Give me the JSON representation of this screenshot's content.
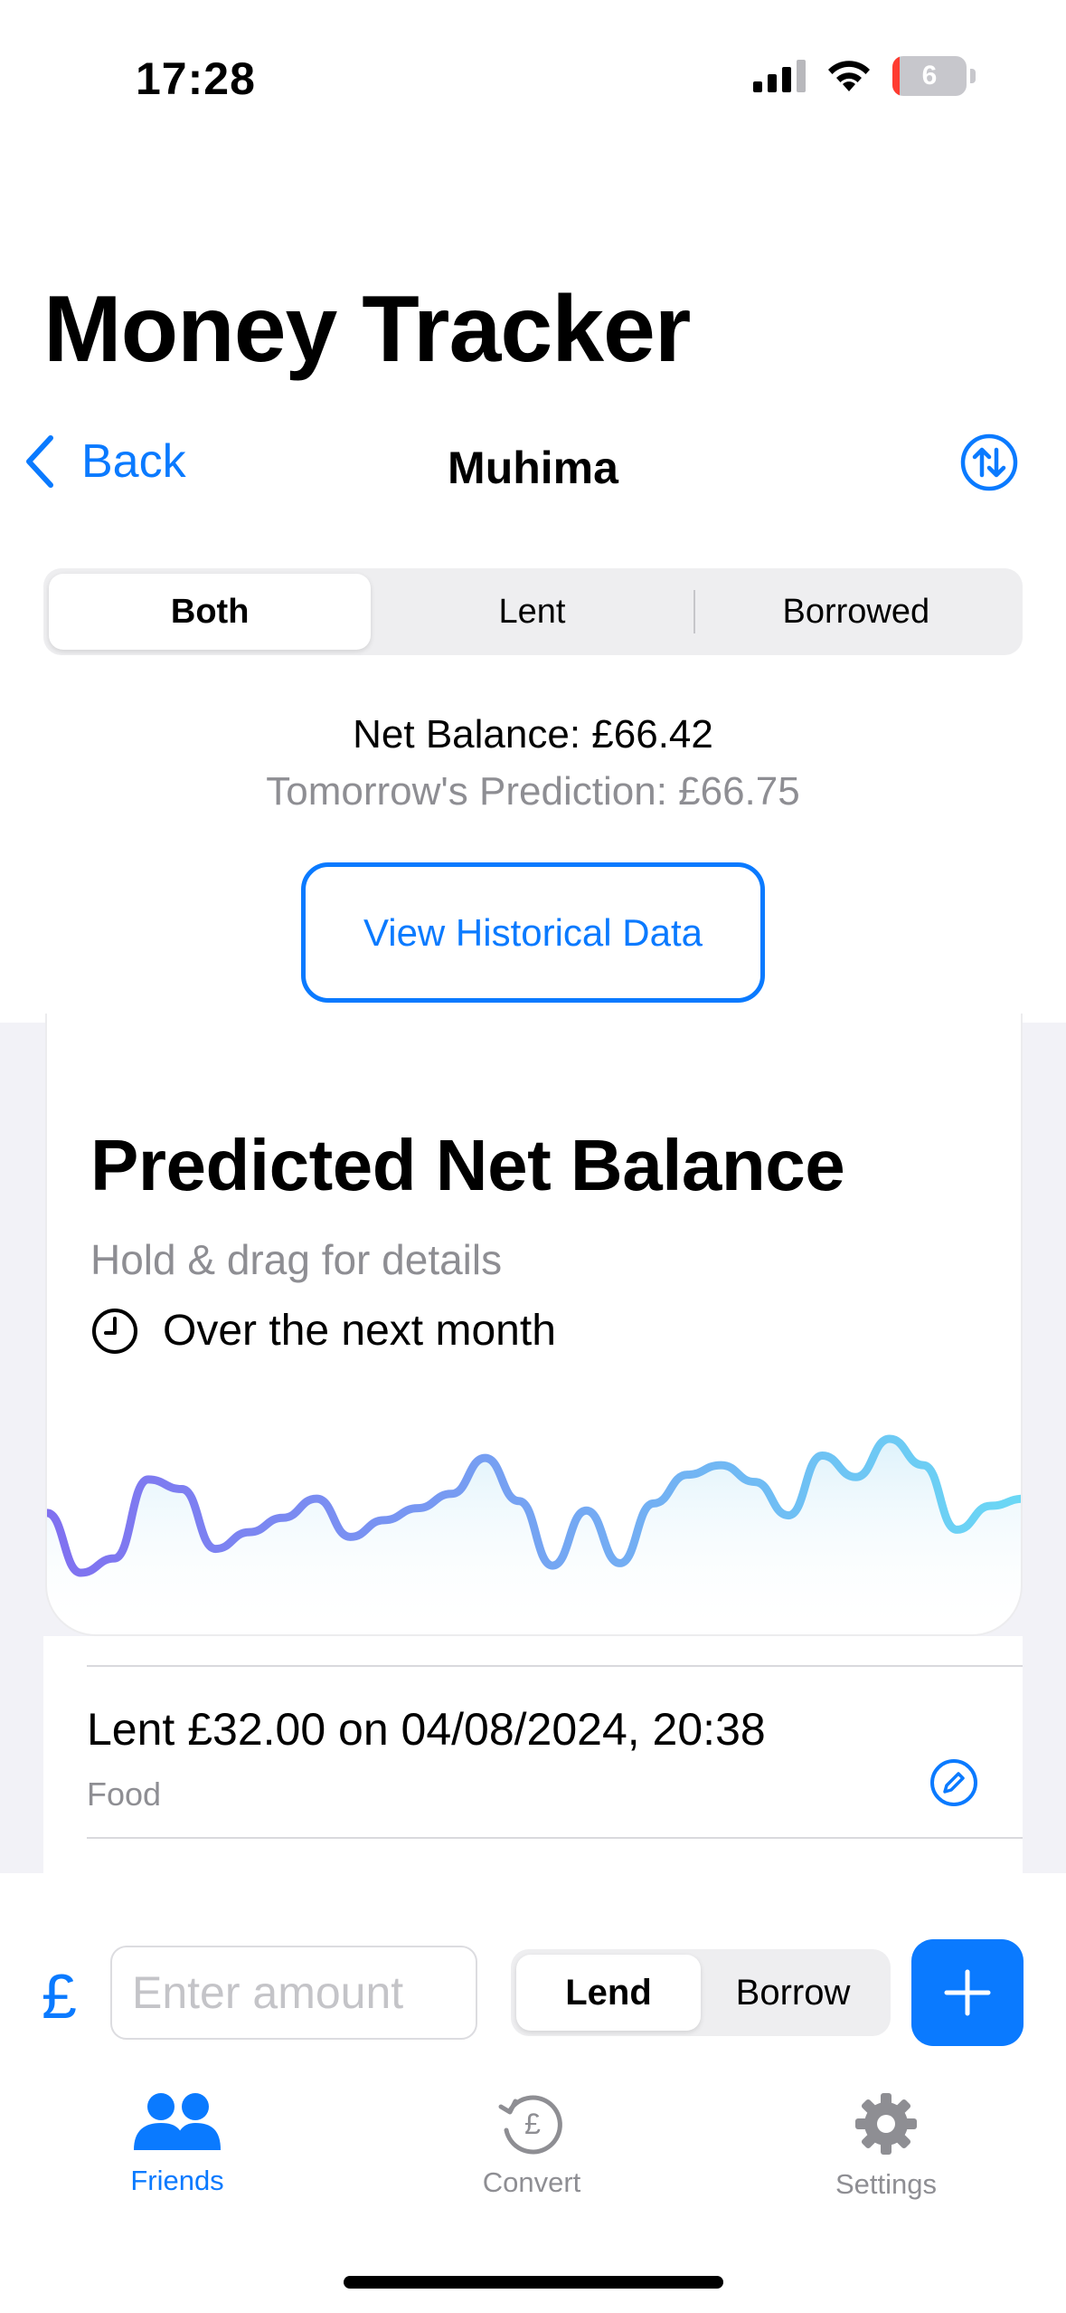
{
  "status_bar": {
    "time": "17:28",
    "battery_level": "6"
  },
  "app": {
    "title": "Money Tracker"
  },
  "nav": {
    "back_label": "Back",
    "title": "Muhima"
  },
  "filter": {
    "options": [
      "Both",
      "Lent",
      "Borrowed"
    ],
    "selected": "Both"
  },
  "summary": {
    "net_balance": "Net Balance: £66.42",
    "prediction": "Tomorrow's Prediction: £66.75"
  },
  "history_button": {
    "label": "View Historical Data"
  },
  "chart": {
    "title": "Predicted Net Balance",
    "hint": "Hold & drag for details",
    "period": "Over the next month",
    "gradient_start": "#8070f0",
    "gradient_end": "#6ad8f5",
    "chart_data": {
      "type": "line",
      "values": [
        62.0,
        59.5,
        60.1,
        63.4,
        63.0,
        60.5,
        61.2,
        61.8,
        62.6,
        61.0,
        61.7,
        62.2,
        62.8,
        64.3,
        62.5,
        59.8,
        62.1,
        59.9,
        62.4,
        63.6,
        64.0,
        63.3,
        61.9,
        64.4,
        63.5,
        65.1,
        64.0,
        61.3,
        62.3,
        62.6
      ],
      "title": "Predicted Net Balance"
    }
  },
  "transaction": {
    "title": "Lent £32.00 on 04/08/2024, 20:38",
    "category": "Food"
  },
  "entry": {
    "currency_symbol": "£",
    "amount_placeholder": "Enter amount",
    "mode_options": [
      "Lend",
      "Borrow"
    ],
    "mode_selected": "Lend"
  },
  "tabs": [
    {
      "label": "Friends",
      "icon": "friends-icon",
      "active": true
    },
    {
      "label": "Convert",
      "icon": "convert-icon",
      "active": false
    },
    {
      "label": "Settings",
      "icon": "settings-icon",
      "active": false
    }
  ],
  "colors": {
    "accent": "#0a7aff",
    "secondary_text": "#8e8e93",
    "background_grouped": "#f2f2f7"
  }
}
